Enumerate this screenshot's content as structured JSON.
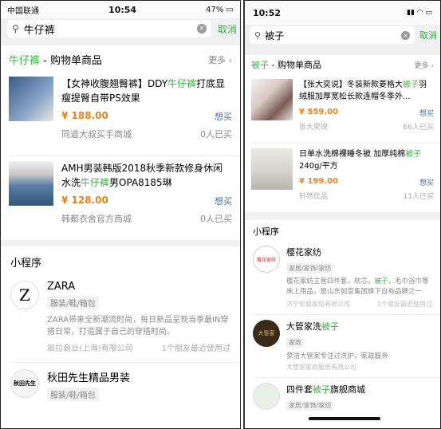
{
  "left": {
    "status": {
      "carrier": "中国联通",
      "time": "10:54",
      "battery": "47%"
    },
    "search": {
      "query": "牛仔裤",
      "cancel": "取消"
    },
    "section": {
      "keyword": "牛仔裤",
      "title": " - 购物单商品",
      "more": "更多 ›"
    },
    "products": [
      {
        "title_pre": "【女神收腹翘臀裤】DDY",
        "title_kw": "牛仔裤",
        "title_post": "打底显瘦提臀自带PS效果",
        "price": "¥ 188.00",
        "want": "想买",
        "shop": "同道大叔买手商城",
        "count": "0人已买"
      },
      {
        "title_pre": "AMH男装韩版2018秋季新款修身休闲水洗",
        "title_kw": "牛仔裤",
        "title_post": "男OPA8185琳",
        "price": "¥ 128.00",
        "want": "想买",
        "shop": "韩都衣舍官方商城",
        "count": "0人已买"
      }
    ],
    "mini_header": "小程序",
    "minis": [
      {
        "logo": "Z",
        "name": "ZARA",
        "tag": "服装/鞋/箱包",
        "desc": "ZARA带来全新潮流时尚，每日新品呈现当季最IN穿搭日常，打造属于自己的穿搭时尚。",
        "company": "飒拉商业(上海)有限公司",
        "used": "1个朋友最近使用过"
      },
      {
        "logo": "秋田先生",
        "name": "秋田先生精品男装",
        "tag": "服装/鞋/箱包"
      }
    ]
  },
  "right": {
    "status": {
      "time": "10:52"
    },
    "search": {
      "query": "被子",
      "cancel": "取消"
    },
    "section": {
      "keyword": "被子",
      "title": " - 购物单商品",
      "more": "更多 ›"
    },
    "products": [
      {
        "title_pre": "【张大奕说】冬装新款菱格大",
        "title_kw": "被子",
        "title_post": "羽绒服加厚宽松长款连帽冬季外...",
        "price": "¥ 559.00",
        "want": "想买",
        "shop": "张大奕说",
        "count": "66人已买"
      },
      {
        "title_pre": "日单水洗棉裸睡冬被 加厚纯棉",
        "title_kw": "被子",
        "title_post": "240g/平方",
        "price": "¥ 199.00",
        "want": "想买",
        "shop": "轩然优品",
        "count": "11人已买"
      }
    ],
    "mini_header": "小程序",
    "minis": [
      {
        "logo": "樱花家纺",
        "name": "樱花家纺",
        "tag": "家居/家饰/家纺",
        "desc_pre": "樱花家纺主营四件套，枕芯，",
        "desc_kw": "被子",
        "desc_post": "，毛巾浴巾等床上用品，是山东如意集团旗下自有品牌之一",
        "company": "济宁如意家纺有限公司",
        "used": "1个朋友最近使用过"
      },
      {
        "logo": "大管家",
        "name_pre": "大管家洗",
        "name_kw": "被子",
        "name_post": "",
        "tag": "家政",
        "desc": "梦洁大管家专注过洗护，家政服务",
        "company": "大管家家政服务有限公司"
      },
      {
        "logo": "",
        "name_pre": "四件套",
        "name_kw": "被子",
        "name_post": "旗舰商城",
        "tag": "家居/家饰/家纺"
      }
    ]
  }
}
